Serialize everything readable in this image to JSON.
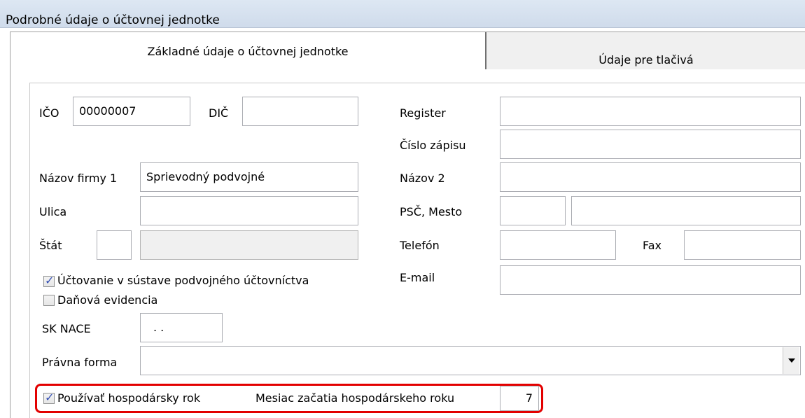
{
  "window": {
    "title": "Podrobné údaje o účtovnej jednotke"
  },
  "tabs": [
    {
      "label": "Základné údaje o účtovnej jednotke",
      "active": true
    },
    {
      "label": "Údaje pre tlačivá",
      "active": false
    }
  ],
  "form": {
    "ico": {
      "label": "IČO",
      "value": "00000007"
    },
    "dic": {
      "label": "DIČ",
      "value": ""
    },
    "register": {
      "label": "Register",
      "value": ""
    },
    "cislo_zapisu": {
      "label": "Číslo zápisu",
      "value": ""
    },
    "nazov_firmy_1": {
      "label": "Názov firmy 1",
      "value": "Sprievodný podvojné"
    },
    "nazov_2": {
      "label": "Názov 2",
      "value": ""
    },
    "ulica": {
      "label": "Ulica",
      "value": ""
    },
    "psc_mesto": {
      "label": "PSČ, Mesto",
      "psc": "",
      "mesto": ""
    },
    "stat": {
      "label": "Štát",
      "code": "",
      "name": ""
    },
    "telefon": {
      "label": "Telefón",
      "value": ""
    },
    "fax": {
      "label": "Fax",
      "value": ""
    },
    "email": {
      "label": "E-mail",
      "value": ""
    },
    "uctovanie_podvojne": {
      "label": "Účtovanie v sústave podvojného účtovníctva",
      "checked": true
    },
    "danova_evidencia": {
      "label": "Daňová evidencia",
      "checked": false
    },
    "sk_nace": {
      "label": "SK NACE",
      "value": ". ."
    },
    "pravna_forma": {
      "label": "Právna forma",
      "value": ""
    },
    "hospodarsky_rok": {
      "label": "Používať hospodársky rok",
      "checked": true
    },
    "mesiac_zacatia": {
      "label": "Mesiac začatia hospodárskeho roku",
      "value": "7"
    }
  },
  "colors": {
    "highlight": "#e30000",
    "check": "#3550b3"
  }
}
